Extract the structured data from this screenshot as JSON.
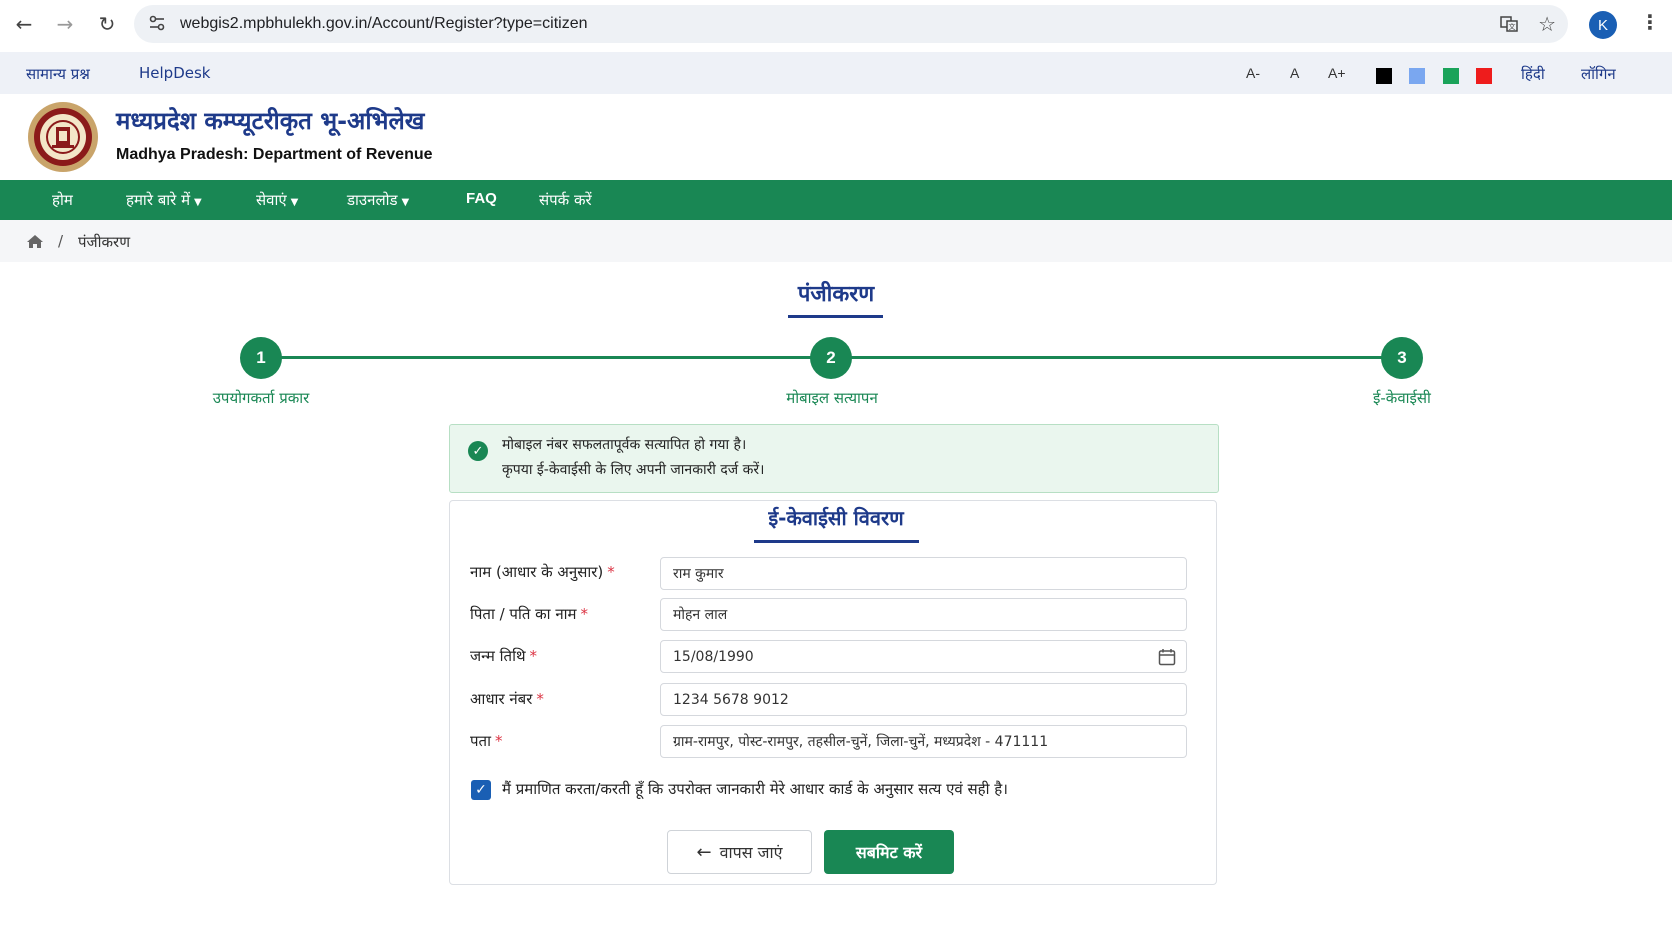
{
  "browser": {
    "url": "webgis2.mpbhulekh.gov.in/Account/Register?type=citizen",
    "profile_initial": "K"
  },
  "utility_bar": {
    "links": [
      "सामान्य प्रश्न",
      "HelpDesk"
    ],
    "font_controls": [
      "A-",
      "A",
      "A+"
    ],
    "theme_colors": [
      "#000000",
      "#7aa7f0",
      "#1aa35a",
      "#ee1c1c"
    ],
    "language": "हिंदी",
    "login": "लॉगिन"
  },
  "header": {
    "title": "मध्यप्रदेश कम्प्यूटरीकृत भू-अभिलेख",
    "subtitle": "Madhya Pradesh: Department of Revenue"
  },
  "nav": {
    "items": [
      "होम",
      "हमारे बारे में",
      "सेवाएं",
      "डाउनलोड",
      "FAQ",
      "संपर्क करें"
    ]
  },
  "breadcrumb": {
    "current": "पंजीकरण"
  },
  "page": {
    "title": "पंजीकरण"
  },
  "stepper": {
    "steps": [
      {
        "number": "1",
        "label": "उपयोगकर्ता प्रकार"
      },
      {
        "number": "2",
        "label": "मोबाइल सत्यापन"
      },
      {
        "number": "3",
        "label": "ई-केवाईसी"
      }
    ]
  },
  "alert": {
    "line1": "मोबाइल नंबर सफलतापूर्वक सत्यापित हो गया है।",
    "line2": "कृपया ई-केवाईसी के लिए अपनी जानकारी दर्ज करें।"
  },
  "form": {
    "title": "ई-केवाईसी विवरण",
    "fields": [
      {
        "label": "नाम (आधार के अनुसार)",
        "value": "राम कुमार"
      },
      {
        "label": "पिता / पति का नाम",
        "value": "मोहन लाल"
      },
      {
        "label": "जन्म तिथि",
        "value": "15/08/1990"
      },
      {
        "label": "आधार नंबर",
        "value": "1234 5678 9012"
      },
      {
        "label": "पता",
        "value": "ग्राम-रामपुर, पोस्ट-रामपुर, तहसील-चुनें, जिला-चुनें, मध्यप्रदेश - 471111"
      }
    ],
    "consent": "मैं प्रमाणित करता/करती हूँ कि उपरोक्त जानकारी मेरे आधार कार्ड के अनुसार सत्य एवं सही है।",
    "consent_checked": true,
    "back_label": "वापस जाएं",
    "submit_label": "सबमिट करें"
  }
}
